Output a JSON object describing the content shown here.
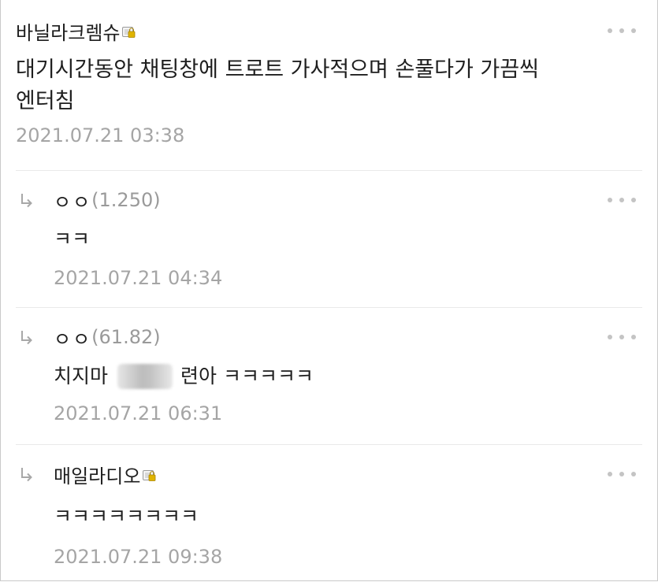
{
  "comments": [
    {
      "author": "바닐라크렘슈",
      "text_line1": "대기시간동안 채팅창에 트로트 가사적으며 손풀다가 가끔씩",
      "text_line2": "엔터침",
      "timestamp": "2021.07.21 03:38",
      "has_badge": true
    }
  ],
  "replies": [
    {
      "author": "ㅇㅇ",
      "author_meta": "(1.250)",
      "text": "ㅋㅋ",
      "timestamp": "2021.07.21 04:34"
    },
    {
      "author": "ㅇㅇ",
      "author_meta": "(61.82)",
      "text_before": "치지마",
      "text_after": "련아 ㅋㅋㅋㅋㅋ",
      "timestamp": "2021.07.21 06:31"
    },
    {
      "author": "매일라디오",
      "text": "ㅋㅋㅋㅋㅋㅋㅋㅋ",
      "timestamp": "2021.07.21 09:38",
      "has_badge": true
    }
  ],
  "icons": {
    "more": "more-options-icon",
    "reply": "reply-arrow-icon",
    "badge": "fixed-nick-badge-icon"
  },
  "colors": {
    "text": "#1e1e1e",
    "meta": "#a5a5a5",
    "divider": "#e9e9e9",
    "badge_gold": "#e0b400"
  }
}
